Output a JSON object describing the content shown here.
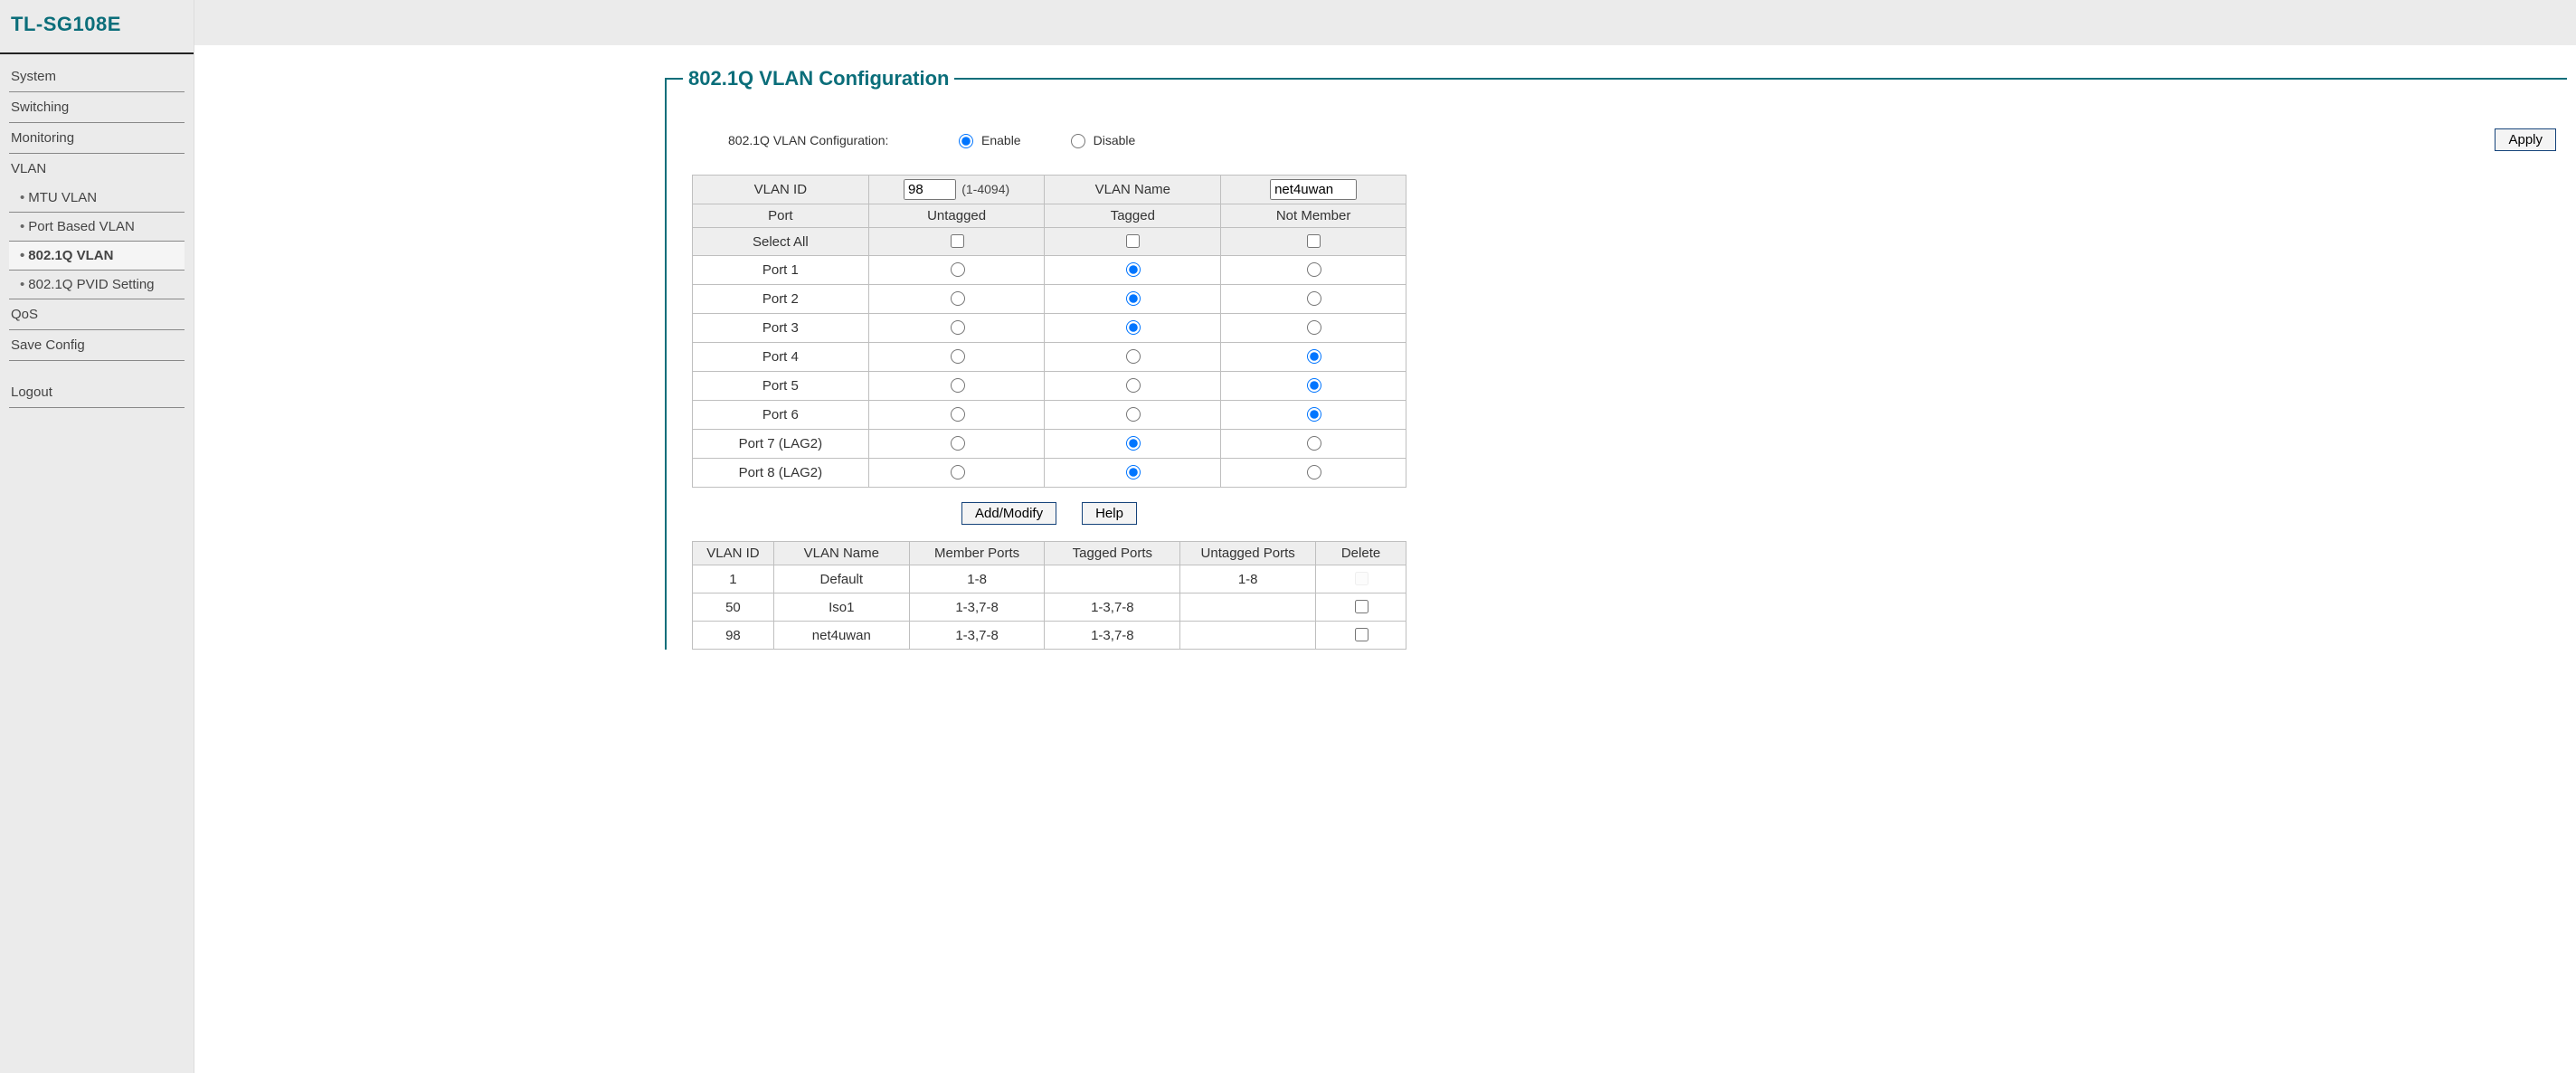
{
  "brand": "TL-SG108E",
  "nav": {
    "system": "System",
    "switching": "Switching",
    "monitoring": "Monitoring",
    "vlan": "VLAN",
    "mtu_vlan": "MTU VLAN",
    "port_based": "Port Based VLAN",
    "dot1q_vlan": "802.1Q VLAN",
    "pvid": "802.1Q PVID Setting",
    "qos": "QoS",
    "save": "Save Config",
    "logout": "Logout"
  },
  "panel_title": "802.1Q VLAN Configuration",
  "cfg": {
    "label": "802.1Q VLAN Configuration:",
    "enable": "Enable",
    "disable": "Disable",
    "selected": "enable",
    "apply": "Apply"
  },
  "port_table": {
    "h_vlanid": "VLAN ID",
    "vlanid_value": "98",
    "vlanid_range": "(1-4094)",
    "h_vlanname": "VLAN Name",
    "vlanname_value": "net4uwan",
    "h_port": "Port",
    "h_untagged": "Untagged",
    "h_tagged": "Tagged",
    "h_notmember": "Not Member",
    "select_all": "Select All",
    "ports": [
      {
        "label": "Port 1",
        "sel": "tagged"
      },
      {
        "label": "Port 2",
        "sel": "tagged"
      },
      {
        "label": "Port 3",
        "sel": "tagged"
      },
      {
        "label": "Port 4",
        "sel": "notmember"
      },
      {
        "label": "Port 5",
        "sel": "notmember"
      },
      {
        "label": "Port 6",
        "sel": "notmember"
      },
      {
        "label": "Port 7 (LAG2)",
        "sel": "tagged"
      },
      {
        "label": "Port 8 (LAG2)",
        "sel": "tagged"
      }
    ]
  },
  "buttons": {
    "add_modify": "Add/Modify",
    "help": "Help"
  },
  "summary": {
    "headers": {
      "vlanid": "VLAN ID",
      "vlanname": "VLAN Name",
      "member": "Member Ports",
      "tagged": "Tagged Ports",
      "untagged": "Untagged Ports",
      "delete": "Delete"
    },
    "rows": [
      {
        "id": "1",
        "name": "Default",
        "member": "1-8",
        "tagged": "",
        "untagged": "1-8",
        "deletable": false
      },
      {
        "id": "50",
        "name": "Iso1",
        "member": "1-3,7-8",
        "tagged": "1-3,7-8",
        "untagged": "",
        "deletable": true
      },
      {
        "id": "98",
        "name": "net4uwan",
        "member": "1-3,7-8",
        "tagged": "1-3,7-8",
        "untagged": "",
        "deletable": true
      }
    ]
  }
}
